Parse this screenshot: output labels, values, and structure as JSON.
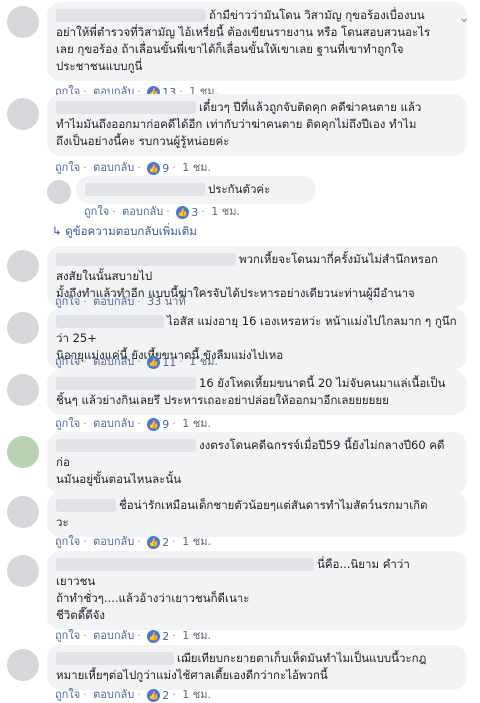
{
  "actions": {
    "like": "ถูกใจ",
    "reply": "ตอบกลับ",
    "sep": "·"
  },
  "colors": {
    "link": "#4b67a1",
    "bubble": "#f2f3f5",
    "like_icon": "#4a76dc"
  },
  "menu_icon": "more-options-icon",
  "comments": [
    {
      "lines": [
        "ถ้ามีข่าวว่ามันโดน วิสามัญ กุขอร้องเบื่องบน",
        "อย่าให้พี่ตำรวจที่วิสามัญ ไอ้เหรี่ยนี้ ต้องเขียนรายงาน หรือ โดนสอบสวนอะไร",
        "เลย กุขอร้อง ถ้าเลื่อนขั้นพี่เขาได้ก็เลื่อนขั้นให้เขาเลย ฐานที่เขาทำถูกใจ",
        "ประชาชนแบบกูนี่"
      ],
      "reactions": "13",
      "time": "1 ชม."
    },
    {
      "lines": [
        "เดี๋ยวๆ ปีที่แล้วถูกจับติดคุก คดีฆ่าคนตาย แล้ว",
        "ทำไมมันถึงออกมาก่อคดีได้อีก เท่ากับว่าฆ่าคนตาย ติดคุกไม่ถึงปีเอง ทำไม",
        "ถึงเป็นอย่างนี้คะ รบกวนผู้รู้หน่อยค่ะ"
      ],
      "reactions": "9",
      "time": "1 ชม."
    },
    {
      "lines": [
        "ประกันตัวค่ะ"
      ],
      "reactions": "3",
      "time": "1 ชม."
    },
    {
      "more_replies": "ดูข้อความตอบกลับเพิ่มเติม"
    },
    {
      "lines": [
        "พวกเหี้ยจะโดนมากี่ครั้งมันไม่สำนึกหรอก สงสัยในนั้นสบายไป",
        "มั้งถึงทำแล้วทำอีก แบบนี้ฆ่าใครจับได้ประหารอย่างเดียวนะท่านผู้มีอำนาจ"
      ],
      "time": "33 นาที"
    },
    {
      "lines": [
        "ไอสัส แม่งอายุ 16 เองเหรอหว่ะ หน้าแม่งไปไกลมาก ๆ กูนึกว่า 25+",
        "นิอายุแม่งแค่นี้ ยังเหี้ยขนาดนี้ ขังลืมแม่งไปเหอ"
      ],
      "reactions": "11",
      "time": "1 ชม."
    },
    {
      "lines": [
        "16 ยังโหดเหี้ยมขนาดนี้ 20 ไม่จับคนมาแล่เนื้อเป็น",
        "ชิ้นๆ แล้วย่างกินเลยรึ ประหารเถอะอย่าปล่อยให้ออกมาอีกเลยยยยยย"
      ],
      "reactions": "9",
      "time": "1 ชม."
    },
    {
      "lines": [
        "งงตรงโดนคดีฉกรรจ์เมื่อปี59 นี้ยังไม่กลางปี60 คดีก่อ",
        "นมันอยู่ขั้นตอนไหนละนั้น"
      ]
    },
    {
      "lines": [
        "ชื่อน่ารักเหมือนเด็กชายตัวน้อยๆแต่สันดารทำไมสัตว์นรกมาเกิด",
        "วะ"
      ],
      "reactions": "2",
      "time": "1 ชม."
    },
    {
      "lines": [
        "นี่คือ...นิยาม คำว่า",
        "เยาวชน",
        "ถ้าทำชั่วๆ....แล้วอ้างว่าเยาวชนก็ดีเนาะ",
        "ชีวิตดี๊ดีจัง"
      ],
      "reactions": "2",
      "time": "1 ชม."
    },
    {
      "lines": [
        "เฌียเทียบกะยายตาเก็บเห็ดมันทำไมเป็นแบบนี้วะกฎ",
        "หมายเหี้ยๆต่อไปกูว่าแม่งไช้ศาลเตี้ยเองดีกว่ากะไอ้พวกนี้"
      ],
      "reactions": "2",
      "time": "1 ชม."
    }
  ]
}
